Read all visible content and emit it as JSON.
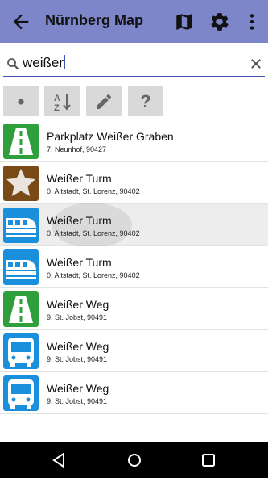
{
  "appbar": {
    "title": "Nürnberg Map",
    "background": "#7d86c9",
    "icons": [
      "back-arrow-icon",
      "map-icon",
      "gear-icon",
      "overflow-menu-icon"
    ]
  },
  "search": {
    "value": "weißer",
    "icon": "search-icon",
    "clear_icon": "close-icon",
    "underline_color": "#3f51b5"
  },
  "toolbar": {
    "buttons": [
      {
        "icon": "dot-icon"
      },
      {
        "icon": "sort-alpha-icon"
      },
      {
        "icon": "pencil-icon"
      },
      {
        "icon": "help-icon",
        "label": "?"
      }
    ]
  },
  "results": [
    {
      "name": "Parkplatz Weißer Graben",
      "address": "7, Neunhof, 90427",
      "icon": "road-icon",
      "color": "#2e9f3a"
    },
    {
      "name": "Weißer Turm",
      "address": "0, Altstadt, St. Lorenz, 90402",
      "icon": "star-icon",
      "color": "#7a4a16"
    },
    {
      "name": "Weißer Turm",
      "address": "0, Altstadt, St. Lorenz, 90402",
      "icon": "train-icon",
      "color": "#1a8fdc"
    },
    {
      "name": "Weißer Turm",
      "address": "0, Altstadt, St. Lorenz, 90402",
      "icon": "train-icon",
      "color": "#1a8fdc"
    },
    {
      "name": "Weißer Weg",
      "address": "9, St. Jobst, 90491",
      "icon": "road-icon",
      "color": "#2e9f3a"
    },
    {
      "name": "Weißer Weg",
      "address": "9, St. Jobst, 90491",
      "icon": "bus-icon",
      "color": "#1a8fdc"
    },
    {
      "name": "Weißer Weg",
      "address": "9, St. Jobst, 90491",
      "icon": "bus-icon",
      "color": "#1a8fdc"
    }
  ],
  "navbar": {
    "icons": [
      "nav-back-icon",
      "nav-home-icon",
      "nav-recents-icon"
    ]
  }
}
